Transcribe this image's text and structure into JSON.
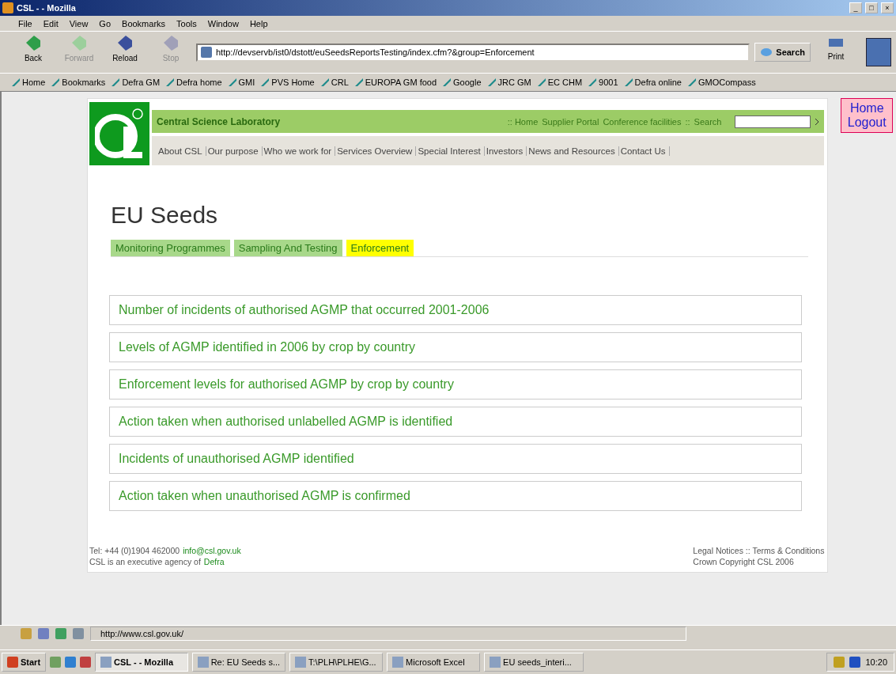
{
  "window": {
    "title": "CSL - - Mozilla",
    "controls": [
      "_",
      "□",
      "×"
    ]
  },
  "menu": [
    "File",
    "Edit",
    "View",
    "Go",
    "Bookmarks",
    "Tools",
    "Window",
    "Help"
  ],
  "toolbar": [
    {
      "label": "Back",
      "disabled": false,
      "color": "#2e9e4a"
    },
    {
      "label": "Forward",
      "disabled": true,
      "color": "#9ccf9c"
    },
    {
      "label": "Reload",
      "disabled": false,
      "color": "#3a4f9c"
    },
    {
      "label": "Stop",
      "disabled": true,
      "color": "#a0a0b8"
    }
  ],
  "url": "http://devservb/ist0/dstott/euSeedsReportsTesting/index.cfm?&group=Enforcement",
  "search_button": "Search",
  "print_button": "Print",
  "bookmarks": [
    "Home",
    "Bookmarks",
    "Defra GM",
    "Defra home",
    "GMI",
    "PVS Home",
    "CRL",
    "EUROPA GM food",
    "Google",
    "JRC GM",
    "EC CHM",
    "9001",
    "Defra online",
    "GMOCompass"
  ],
  "site": {
    "brand": "Central Science Laboratory",
    "top_links": [
      ":: Home",
      "Supplier Portal",
      "Conference facilities",
      "::",
      "Search"
    ],
    "nav": [
      "About CSL",
      "Our purpose",
      "Who we work for",
      "Services Overview",
      "Special Interest",
      "Investors",
      "News and Resources",
      "Contact Us"
    ],
    "side_links": [
      "Home",
      "Logout"
    ],
    "heading": "EU Seeds",
    "tabs": [
      {
        "label": "Monitoring Programmes",
        "selected": false
      },
      {
        "label": "Sampling And Testing",
        "selected": false
      },
      {
        "label": "Enforcement",
        "selected": true
      }
    ],
    "reports": [
      "Number of incidents of authorised AGMP that occurred 2001-2006",
      "Levels of AGMP identified in 2006 by crop by country",
      "Enforcement levels for authorised AGMP by crop by country",
      "Action taken when authorised unlabelled AGMP is identified",
      "Incidents of unauthorised AGMP identified",
      "Action taken when unauthorised AGMP is confirmed"
    ],
    "footer": {
      "tel": "Tel: +44 (0)1904 462000",
      "email": "info@csl.gov.uk",
      "agency": "CSL is an executive agency of",
      "defra": "Defra",
      "legal": "Legal Notices :: Terms & Conditions",
      "copyright": "Crown Copyright CSL 2006"
    }
  },
  "status_bar": {
    "text": "http://www.csl.gov.uk/"
  },
  "taskbar": {
    "start": "Start",
    "tasks": [
      {
        "label": "CSL - - Mozilla",
        "selected": true
      },
      {
        "label": "Re: EU Seeds s...",
        "selected": false
      },
      {
        "label": "T:\\PLH\\PLHE\\G...",
        "selected": false
      },
      {
        "label": "Microsoft Excel",
        "selected": false
      },
      {
        "label": "EU seeds_interi...",
        "selected": false
      }
    ],
    "clock": "10:20"
  }
}
